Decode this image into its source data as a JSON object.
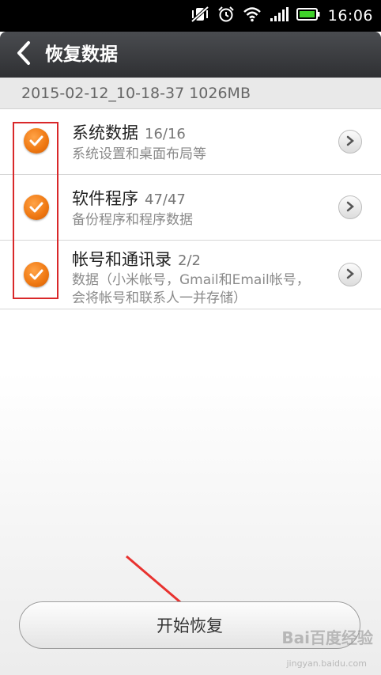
{
  "status_bar": {
    "time": "16:06",
    "icons": [
      "mute-vibrate-icon",
      "alarm-icon",
      "wifi-icon",
      "signal-icon",
      "battery-icon"
    ]
  },
  "header": {
    "title": "恢复数据",
    "back_icon": "chevron-left-icon"
  },
  "backup_info": "2015-02-12_10-18-37   1026MB",
  "items": [
    {
      "title": "系统数据",
      "count": "16/16",
      "desc": "系统设置和桌面布局等",
      "checked": true
    },
    {
      "title": "软件程序",
      "count": "47/47",
      "desc": "备份程序和程序数据",
      "checked": true
    },
    {
      "title": "帐号和通讯录",
      "count": "2/2",
      "desc": "数据（小米帐号，Gmail和Email帐号，会将帐号和联系人一并存储）",
      "checked": true
    }
  ],
  "start_button": "开始恢复",
  "watermark": "Bai百度经验",
  "watermark_url": "jingyan.baidu.com",
  "colors": {
    "accent": "#f07a14",
    "highlight": "#d9282a",
    "titlebar": "#3a3b3e"
  }
}
